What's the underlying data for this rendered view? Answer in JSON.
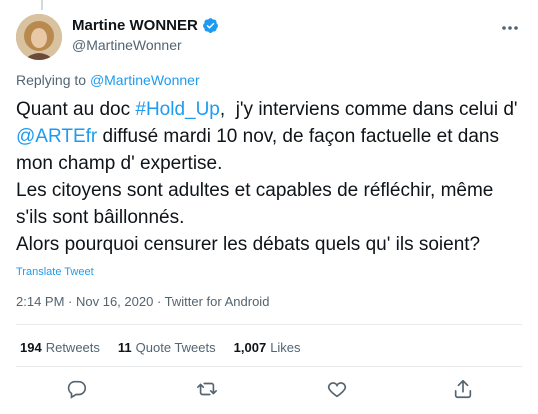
{
  "author": {
    "display_name": "Martine WONNER",
    "handle": "@MartineWonner",
    "verified": true
  },
  "reply": {
    "prefix": "Replying to ",
    "to": "@MartineWonner"
  },
  "tweet": {
    "line1_a": "Quant au doc ",
    "hashtag": "#Hold_Up",
    "line1_b": ",  j'y interviens comme dans celui d' ",
    "mention": "@ARTEfr",
    "line2": " diffusé mardi 10 nov, de façon factuelle et dans mon champ d' expertise.\nLes citoyens sont adultes et capables de réfléchir, même s'ils sont bâillonnés.\nAlors pourquoi censurer les débats quels qu' ils soient?"
  },
  "translate_label": "Translate Tweet",
  "meta": {
    "time": "2:14 PM",
    "sep1": " · ",
    "date": "Nov 16, 2020",
    "sep2": " · ",
    "source": "Twitter for Android"
  },
  "stats": {
    "retweets_count": "194",
    "retweets_label": "Retweets",
    "quotes_count": "11",
    "quotes_label": "Quote Tweets",
    "likes_count": "1,007",
    "likes_label": "Likes"
  },
  "icons": {
    "verified": "verified-badge-icon",
    "more": "more-icon",
    "reply": "reply-icon",
    "retweet": "retweet-icon",
    "like": "like-icon",
    "share": "share-icon"
  },
  "colors": {
    "link": "#1d9bf0",
    "text": "#0f1419",
    "secondary": "#536471",
    "divider": "#e7ebee"
  }
}
